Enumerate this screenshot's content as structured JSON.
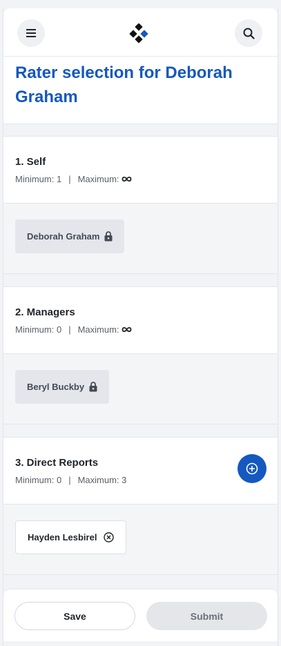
{
  "header": {
    "menu_icon": "hamburger-menu-icon",
    "logo_icon": "diamond-logo-icon",
    "search_icon": "search-icon"
  },
  "page": {
    "title": "Rater selection for Deborah Graham"
  },
  "sections": [
    {
      "title": "1. Self",
      "minimum_label": "Minimum: 1",
      "separator": "|",
      "maximum_label": "Maximum:",
      "maximum_icon": "infinity-icon",
      "raters": [
        {
          "name": "Deborah Graham",
          "locked": true
        }
      ]
    },
    {
      "title": "2. Managers",
      "minimum_label": "Minimum: 0",
      "separator": "|",
      "maximum_label": "Maximum:",
      "maximum_icon": "infinity-icon",
      "raters": [
        {
          "name": "Beryl Buckby",
          "locked": true
        }
      ]
    },
    {
      "title": "3. Direct Reports",
      "minimum_label": "Minimum: 0",
      "separator": "|",
      "maximum_label": "Maximum: 3",
      "add_icon": "add-circle-icon",
      "raters": [
        {
          "name": "Hayden Lesbirel",
          "locked": false
        }
      ]
    }
  ],
  "footer": {
    "save_label": "Save",
    "submit_label": "Submit"
  },
  "colors": {
    "accent": "#1558c0",
    "background": "#f1f3f6",
    "locked_chip": "#e4e6ec"
  }
}
